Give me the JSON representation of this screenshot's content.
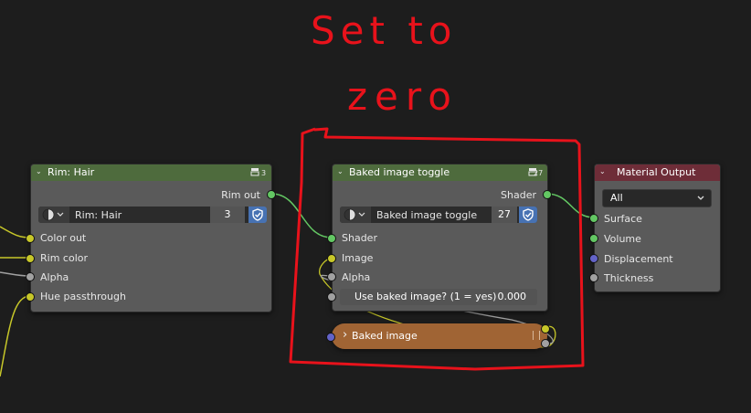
{
  "annotation": {
    "line1": "Set to",
    "line2": "zero",
    "color": "#e8121b"
  },
  "nodes": {
    "rim_hair": {
      "title": "Rim: Hair",
      "header_color": "#4e6b3d",
      "users_count": "3",
      "output_label": "Rim out",
      "group_selector": {
        "name": "Rim: Hair",
        "users": "3"
      },
      "inputs": [
        "Color out",
        "Rim color",
        "Alpha",
        "Hue passthrough"
      ]
    },
    "baked_toggle": {
      "title": "Baked image toggle",
      "header_color": "#4e6b3d",
      "users_count": "27",
      "output_label": "Shader",
      "group_selector": {
        "name": "Baked image toggle",
        "users": "27"
      },
      "inputs": [
        "Shader",
        "Image",
        "Alpha"
      ],
      "field": {
        "label": "Use baked image? (1 = yes)",
        "value": "0.000"
      }
    },
    "material_output": {
      "title": "Material Output",
      "header_color": "#6e2d38",
      "target": "All",
      "inputs": [
        "Surface",
        "Volume",
        "Displacement",
        "Thickness"
      ]
    },
    "frame": {
      "title": "Baked image",
      "color": "#a06434"
    }
  },
  "icons": {
    "chevron_down": "⌄",
    "chevron_right": "›",
    "group_icon": "node-group-icon",
    "shield": "fake-user-shield-icon",
    "material": "material-sphere-icon"
  },
  "socket_colors": {
    "shader": "#63c763",
    "color": "#c7c729",
    "float": "#a1a1a1",
    "vector": "#6363c7"
  }
}
